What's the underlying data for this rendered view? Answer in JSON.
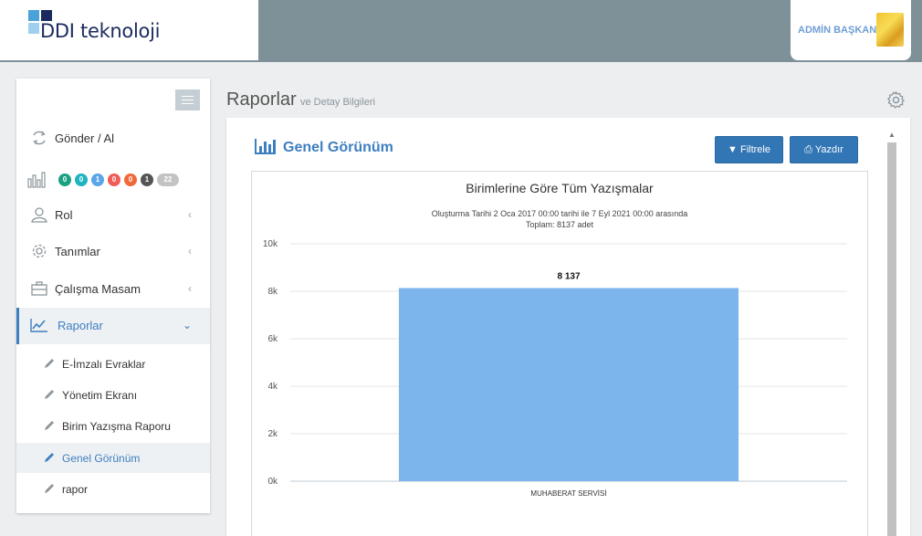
{
  "header": {
    "logo_text": "DDI teknoloji",
    "user_name": "ADMİN BAŞKAN",
    "colors": {
      "bar": "#7e9199",
      "logo_dark": "#1b2a5e",
      "logo_light": "#4aa3d8"
    }
  },
  "sidebar": {
    "items": [
      {
        "label": "Gönder / Al",
        "icon": "refresh-icon"
      },
      {
        "label": "Rol",
        "icon": "user-icon"
      },
      {
        "label": "Tanımlar",
        "icon": "gear-icon"
      },
      {
        "label": "Çalışma Masam",
        "icon": "briefcase-icon"
      },
      {
        "label": "Raporlar",
        "icon": "line-chart-icon"
      }
    ],
    "badges": [
      {
        "value": "0",
        "color": "#1ba084"
      },
      {
        "value": "0",
        "color": "#1fb5c0"
      },
      {
        "value": "1",
        "color": "#5aa6e8"
      },
      {
        "value": "0",
        "color": "#f05c56"
      },
      {
        "value": "0",
        "color": "#f0693a"
      },
      {
        "value": "1",
        "color": "#555555"
      },
      {
        "value": "22",
        "color": "#c3c3c3"
      }
    ],
    "sub_items": [
      {
        "label": "E-İmzalı Evraklar"
      },
      {
        "label": "Yönetim Ekranı"
      },
      {
        "label": "Birim Yazışma Raporu"
      },
      {
        "label": "Genel Görünüm"
      },
      {
        "label": "rapor"
      }
    ]
  },
  "page": {
    "title": "Raporlar",
    "subtitle": "ve Detay Bilgileri"
  },
  "panel": {
    "title": "Genel Görünüm",
    "filter_label": "Filtrele",
    "print_label": "Yazdır"
  },
  "chart_data": {
    "type": "bar",
    "title": "Birimlerine Göre Tüm Yazışmalar",
    "subtitle_line1": "Oluşturma Tarihi 2 Oca 2017 00:00 tarihi ile 7 Eyl 2021 00:00 arasında",
    "subtitle_line2": "Toplam: 8137 adet",
    "categories": [
      "MUHABERAT SERVİSİ"
    ],
    "values": [
      8137
    ],
    "data_labels": [
      "8 137"
    ],
    "y_ticks": [
      "0k",
      "2k",
      "4k",
      "6k",
      "8k",
      "10k"
    ],
    "ylim": [
      0,
      10000
    ],
    "grid": true,
    "bar_color": "#7cb5ec"
  }
}
